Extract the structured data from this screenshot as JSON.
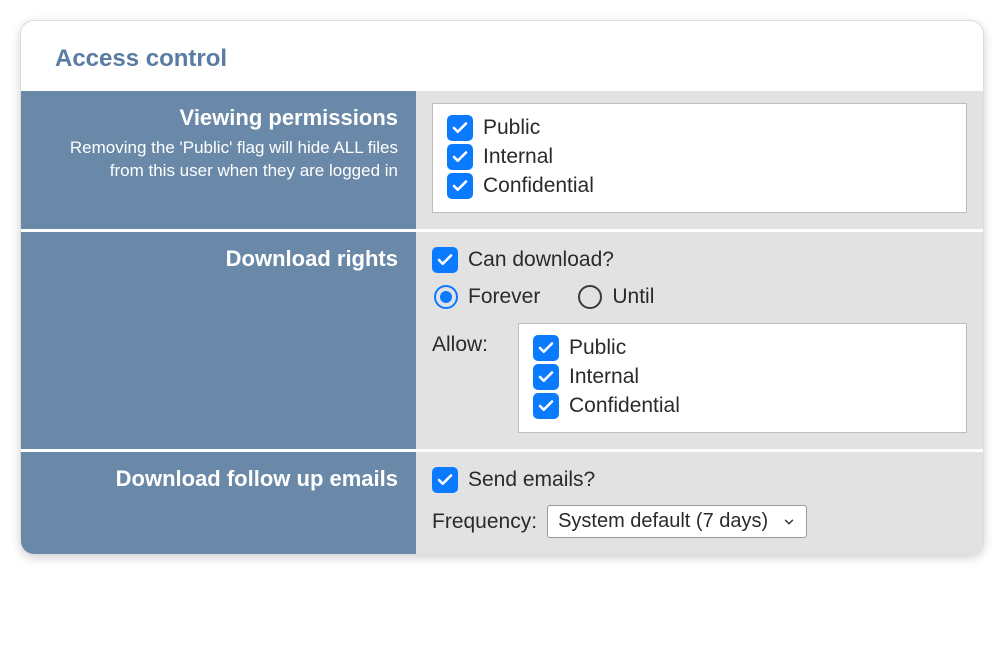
{
  "title": "Access control",
  "viewing": {
    "label": "Viewing permissions",
    "desc": "Removing the 'Public' flag will hide ALL files from this user when they are logged in",
    "options": {
      "public": "Public",
      "internal": "Internal",
      "confidential": "Confidential"
    }
  },
  "download": {
    "label": "Download rights",
    "can_label": "Can download?",
    "forever": "Forever",
    "until": "Until",
    "allow_label": "Allow:",
    "options": {
      "public": "Public",
      "internal": "Internal",
      "confidential": "Confidential"
    }
  },
  "emails": {
    "label": "Download follow up emails",
    "send_label": "Send emails?",
    "freq_label": "Frequency:",
    "freq_value": "System default (7 days)"
  }
}
